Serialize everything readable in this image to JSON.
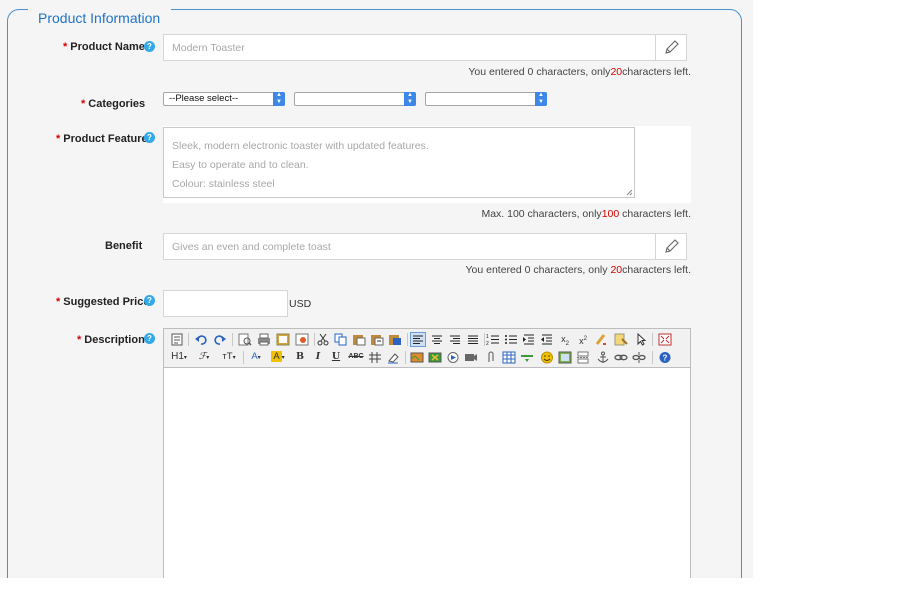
{
  "section": {
    "legend": "Product Information"
  },
  "product_name": {
    "required_mark": "*",
    "label": "Product Name",
    "help": "?",
    "placeholder": "Modern Toaster",
    "hint_before": "You entered 0 characters, only",
    "hint_count": "20",
    "hint_after": "characters left."
  },
  "categories": {
    "required_mark": "*",
    "label": "Categories",
    "select1_value": "--Please select--",
    "select2_value": "",
    "select3_value": ""
  },
  "product_feature": {
    "required_mark": "*",
    "label": "Product Feature",
    "help": "?",
    "placeholder_lines": [
      "Sleek, modern electronic toaster with updated features.",
      "Easy to operate and to clean.",
      "Colour: stainless steel"
    ],
    "hint_before": "Max. 100 characters, only",
    "hint_count": "100",
    "hint_after": " characters left."
  },
  "benefit": {
    "label": "Benefit",
    "placeholder": "Gives an even and complete toast",
    "hint_before": "You entered 0 characters, only ",
    "hint_count": "20",
    "hint_after": "characters left."
  },
  "suggested_price": {
    "required_mark": "*",
    "label": "Suggested Price",
    "help": "?",
    "value": "",
    "currency": "USD"
  },
  "description": {
    "required_mark": "*",
    "label": "Description",
    "help": "?",
    "toolbar_row1": [
      "source-icon",
      "undo-icon",
      "redo-icon",
      "preview-icon",
      "print-icon",
      "templates-icon",
      "save-icon",
      "cut-icon",
      "copy-icon",
      "paste-icon",
      "paste-text-icon",
      "paste-word-icon",
      "align-left-icon",
      "align-center-icon",
      "align-right-icon",
      "align-justify-icon",
      "numbered-list-icon",
      "bulleted-list-icon",
      "indent-icon",
      "outdent-icon",
      "subscript-icon",
      "superscript-icon",
      "clear-format-icon",
      "select-all-icon",
      "cursor-icon",
      "fullscreen-icon"
    ],
    "toolbar_row2": {
      "heading": "H1",
      "font_family": "ℱ",
      "font_size": "ᴛT",
      "font_color": "A",
      "highlight": "A",
      "bold": "B",
      "italic": "I",
      "underline": "U",
      "strikethrough": "ABC"
    }
  }
}
